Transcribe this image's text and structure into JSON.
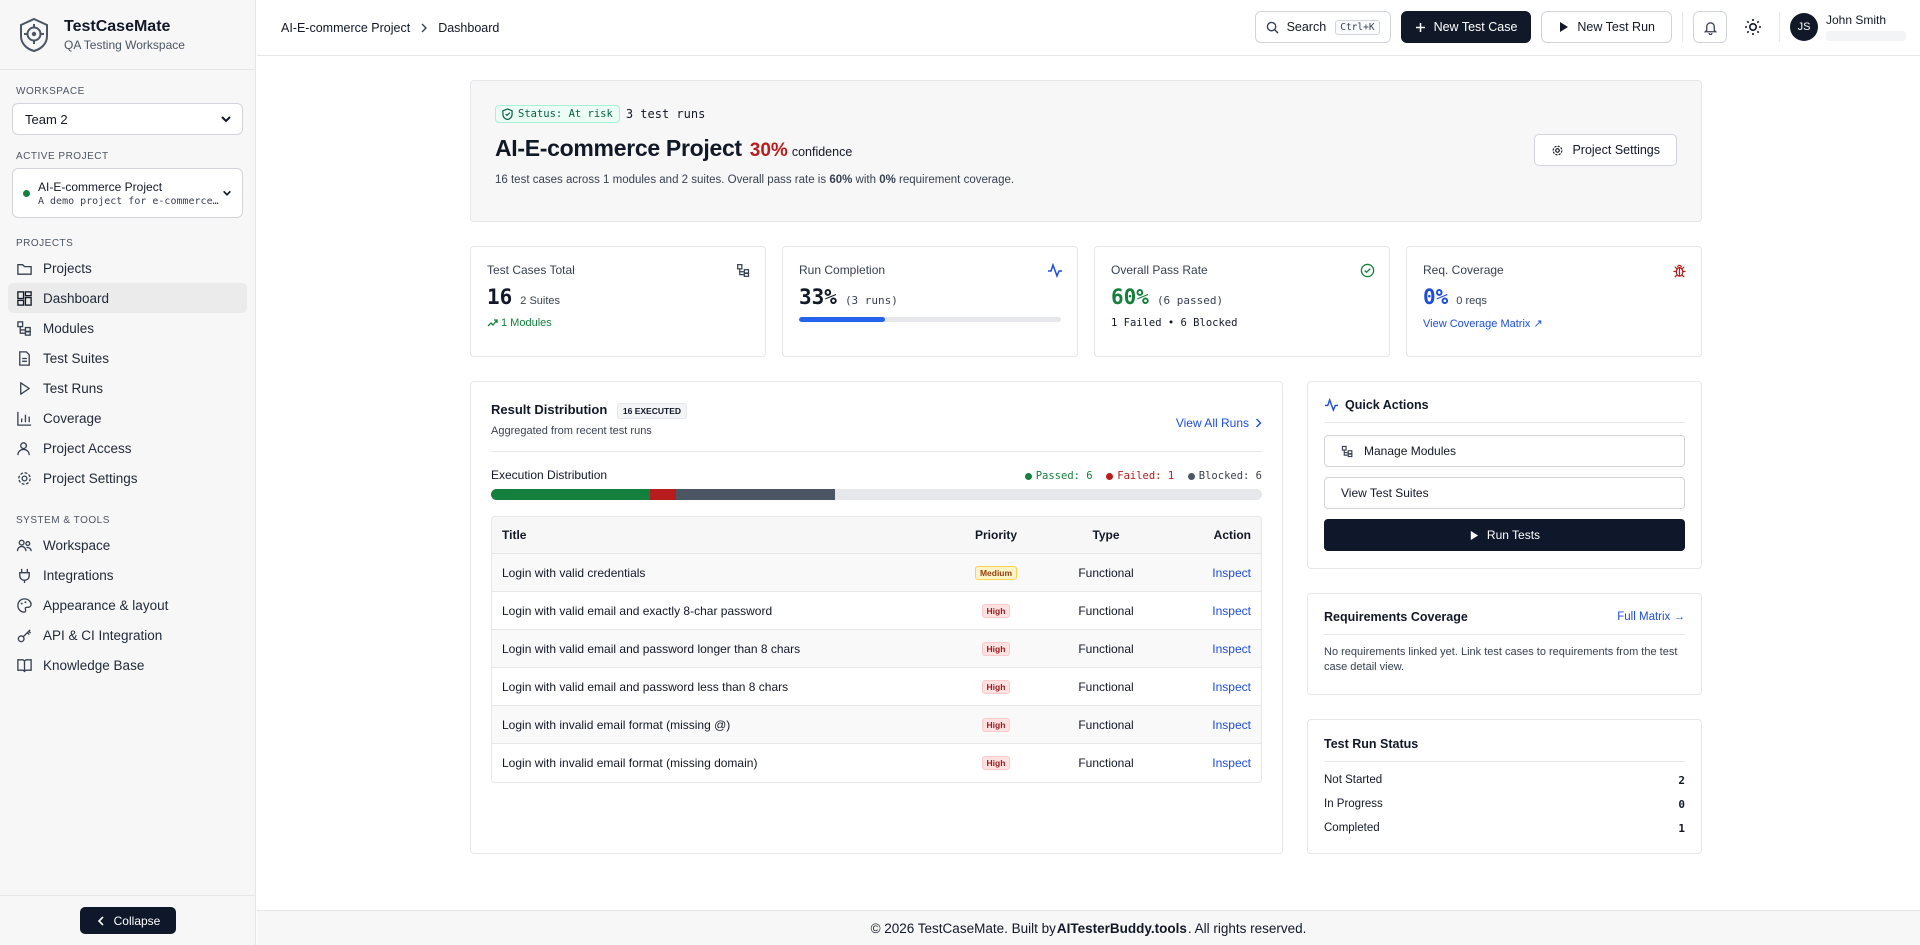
{
  "brand": {
    "name": "TestCaseMate",
    "subtitle": "QA Testing Workspace"
  },
  "sidebar": {
    "workspace_label": "WORKSPACE",
    "workspace_value": "Team 2",
    "active_project_label": "ACTIVE PROJECT",
    "active_project": {
      "name": "AI-E-commerce Project",
      "description": "A demo project for e-commerce testing"
    },
    "projects_label": "PROJECTS",
    "project_items": [
      {
        "label": "Projects",
        "icon": "folder-icon"
      },
      {
        "label": "Dashboard",
        "icon": "dashboard-icon",
        "active": true
      },
      {
        "label": "Modules",
        "icon": "modules-icon"
      },
      {
        "label": "Test Suites",
        "icon": "file-icon"
      },
      {
        "label": "Test Runs",
        "icon": "play-icon"
      },
      {
        "label": "Coverage",
        "icon": "chart-icon"
      },
      {
        "label": "Project Access",
        "icon": "users-icon"
      },
      {
        "label": "Project Settings",
        "icon": "gear-icon"
      }
    ],
    "system_label": "SYSTEM & TOOLS",
    "system_items": [
      {
        "label": "Workspace",
        "icon": "team-icon"
      },
      {
        "label": "Integrations",
        "icon": "plug-icon"
      },
      {
        "label": "Appearance & layout",
        "icon": "palette-icon"
      },
      {
        "label": "API & CI Integration",
        "icon": "key-icon"
      },
      {
        "label": "Knowledge Base",
        "icon": "book-icon"
      }
    ],
    "collapse_label": "Collapse"
  },
  "header": {
    "breadcrumb": [
      "AI-E-commerce Project",
      "Dashboard"
    ],
    "search_label": "Search",
    "search_shortcut": "Ctrl+K",
    "new_test_case": "New Test Case",
    "new_test_run": "New Test Run",
    "user_initials": "JS",
    "user_name": "John Smith"
  },
  "hero": {
    "status": "Status: At risk",
    "runs": "3 test runs",
    "title": "AI-E-commerce Project",
    "confidence_value": "30%",
    "confidence_label": "confidence",
    "desc_prefix": "16 test cases across 1 modules and 2 suites. Overall pass rate is ",
    "desc_pass": "60%",
    "desc_mid": " with ",
    "desc_cov": "0%",
    "desc_suffix": " requirement coverage.",
    "settings_button": "Project Settings"
  },
  "stats": [
    {
      "label": "Test Cases Total",
      "value": "16",
      "sub": "2 Suites",
      "foot": "1 Modules",
      "icon": "modules-icon"
    },
    {
      "label": "Run Completion",
      "value": "33%",
      "sub": "(3 runs)",
      "progress": 0.33,
      "icon": "activity-icon"
    },
    {
      "label": "Overall Pass Rate",
      "value": "60%",
      "sub": "(6 passed)",
      "foot": "1 Failed • 6 Blocked",
      "icon": "check-circle-icon"
    },
    {
      "label": "Req. Coverage",
      "value": "0%",
      "sub": "0 reqs",
      "foot": "View Coverage Matrix ↗",
      "icon": "bug-icon"
    }
  ],
  "result_distribution": {
    "title": "Result Distribution",
    "badge": "16 EXECUTED",
    "subtitle": "Aggregated from recent test runs",
    "view_all": "View All Runs",
    "exec_label": "Execution Distribution",
    "legend": [
      {
        "label": "Passed: 6",
        "color": "#15803d"
      },
      {
        "label": "Failed: 1",
        "color": "#b91c1c"
      },
      {
        "label": "Blocked: 6",
        "color": "#4b5563"
      }
    ],
    "bar_fractions": {
      "passed": 0.206,
      "failed": 0.034,
      "blocked": 0.206
    },
    "columns": [
      "Title",
      "Priority",
      "Type",
      "Action"
    ],
    "rows": [
      {
        "title": "Login with valid credentials",
        "priority": "Medium",
        "type": "Functional",
        "action": "Inspect"
      },
      {
        "title": "Login with valid email and exactly 8-char password",
        "priority": "High",
        "type": "Functional",
        "action": "Inspect"
      },
      {
        "title": "Login with valid email and password longer than 8 chars",
        "priority": "High",
        "type": "Functional",
        "action": "Inspect"
      },
      {
        "title": "Login with valid email and password less than 8 chars",
        "priority": "High",
        "type": "Functional",
        "action": "Inspect"
      },
      {
        "title": "Login with invalid email format (missing @)",
        "priority": "High",
        "type": "Functional",
        "action": "Inspect"
      },
      {
        "title": "Login with invalid email format (missing domain)",
        "priority": "High",
        "type": "Functional",
        "action": "Inspect"
      }
    ]
  },
  "quick_actions": {
    "title": "Quick Actions",
    "manage_modules": "Manage Modules",
    "view_suites": "View Test Suites",
    "run_tests": "Run Tests"
  },
  "requirements": {
    "title": "Requirements Coverage",
    "link": "Full Matrix →",
    "text": "No requirements linked yet. Link test cases to requirements from the test case detail view."
  },
  "test_run_status": {
    "title": "Test Run Status",
    "rows": [
      {
        "label": "Not Started",
        "value": "2"
      },
      {
        "label": "In Progress",
        "value": "0"
      },
      {
        "label": "Completed",
        "value": "1"
      }
    ]
  },
  "footer": {
    "prefix": "© 2026 TestCaseMate. Built by ",
    "link": "AITesterBuddy.tools",
    "suffix": ". All rights reserved."
  }
}
